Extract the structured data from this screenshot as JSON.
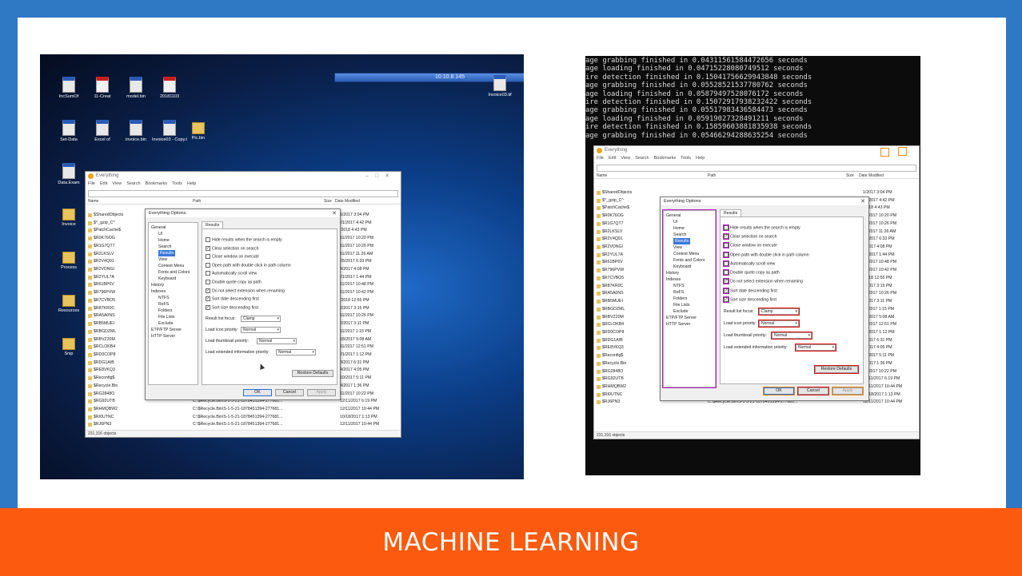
{
  "slide": {
    "footer_title": "MACHINE LEARNING"
  },
  "left": {
    "topbar_title": "10.10.8.145",
    "desktop_icons": [
      {
        "label": "IncSumOf",
        "kind": "doc"
      },
      {
        "label": "11-Creat",
        "kind": "pdf"
      },
      {
        "label": "model.bin",
        "kind": "doc"
      },
      {
        "label": "20181103",
        "kind": "pdf"
      },
      {
        "label": "Set-Data",
        "kind": "doc"
      },
      {
        "label": "Excel of",
        "kind": "doc"
      },
      {
        "label": "invoice.bin",
        "kind": "doc"
      },
      {
        "label": "Invoice03 - Copy.tif",
        "kind": "doc"
      },
      {
        "label": "Pic.bin",
        "kind": "fold"
      },
      {
        "label": "Data.Exam",
        "kind": "doc"
      },
      {
        "label": "Invoice",
        "kind": "fold"
      },
      {
        "label": "Process",
        "kind": "fold"
      },
      {
        "label": "Resources",
        "kind": "fold"
      },
      {
        "label": "Snip",
        "kind": "fold"
      }
    ],
    "top_right_icon_label": "Invoice03.tif"
  },
  "everything": {
    "title": "Everything",
    "menu": [
      "File",
      "Edit",
      "View",
      "Search",
      "Bookmarks",
      "Tools",
      "Help"
    ],
    "columns": {
      "name": "Name",
      "path": "Path",
      "size": "Size",
      "date": "Date Modified"
    },
    "rows": [
      {
        "name": "$SharedObjects",
        "path": "",
        "date": "1/2017 3:04 PM"
      },
      {
        "name": "$^_gzip_C^",
        "path": "",
        "date": "21/2017 4:42 PM"
      },
      {
        "name": "$PatchCache$",
        "path": "",
        "date": "/2018 4:43 PM"
      },
      {
        "name": "$R0K76OG",
        "path": "",
        "date": "11/2017 10:20 PM"
      },
      {
        "name": "$R1G7QT7",
        "path": "",
        "date": "11/2017 10:26 PM"
      },
      {
        "name": "$R2LKSLV",
        "path": "",
        "date": "11/2017 11:26 AM"
      },
      {
        "name": "$R2V4Q91",
        "path": "",
        "date": "25/2017 6:33 PM"
      },
      {
        "name": "$R2VDNGI",
        "path": "",
        "date": "4/2017 4:08 PM"
      },
      {
        "name": "$R2YUL7A",
        "path": "",
        "date": "21/2017 1:44 PM"
      },
      {
        "name": "$R61BP6V",
        "path": "",
        "date": "11/2017 10:48 PM"
      },
      {
        "name": "$R796PVW",
        "path": "",
        "date": "11/2017 10:42 PM"
      },
      {
        "name": "$R7CVBO5",
        "path": "",
        "date": "/2018 12:55 PM"
      },
      {
        "name": "$R87KR0C",
        "path": "",
        "date": "2/2017 3:15 PM"
      },
      {
        "name": "$RA5A0NS",
        "path": "",
        "date": "11/2017 10:26 PM"
      },
      {
        "name": "$RB5MUEI",
        "path": "",
        "date": "2/2017 3:11 PM"
      },
      {
        "name": "$RBGDZML",
        "path": "",
        "date": "11/2017 1:15 PM"
      },
      {
        "name": "$RBVZ20M",
        "path": "",
        "date": "18/2017 5:08 AM"
      },
      {
        "name": "$RCLOKB4",
        "path": "",
        "date": "11/2017 12:51 PM"
      },
      {
        "name": "$RD0COP8",
        "path": "",
        "date": "21/2017 1:12 PM"
      },
      {
        "name": "$RDG1AIB",
        "path": "",
        "date": "3/2017 6:31 PM"
      },
      {
        "name": "$RE8VKQ3",
        "path": "",
        "date": "4/2017 4:05 PM"
      },
      {
        "name": "$Reconfig$",
        "path": "",
        "date": "10/2017 5:11 PM"
      },
      {
        "name": "$Recycle.Bin",
        "path": "",
        "date": "4/2017 1:36 PM"
      },
      {
        "name": "$RG2848O",
        "path": "",
        "date": "11/2017 10:22 PM"
      },
      {
        "name": "$RG92UTB",
        "path": "C:\\$Recycle.Bin\\S-1-5-21-1878451394-277681...",
        "date": "12/11/2017 6:19 PM"
      },
      {
        "name": "$RHMQBW2",
        "path": "C:\\$Recycle.Bin\\S-1-5-21-1878451394-277681...",
        "date": "12/11/2017 10:44 PM"
      },
      {
        "name": "$RI0UTNC",
        "path": "C:\\$Recycle.Bin\\S-1-5-21-1878451394-277681...",
        "date": "10/18/2017 1:13 PM"
      },
      {
        "name": "$RJ6PN3",
        "path": "C:\\$Recycle.Bin\\S-1-5-21-1878451394-277681...",
        "date": "12/11/2017 10:44 PM"
      }
    ],
    "status": "231,316 objects"
  },
  "options": {
    "title": "Everything Options",
    "tree": [
      {
        "label": "General",
        "indent": 0
      },
      {
        "label": "UI",
        "indent": 1
      },
      {
        "label": "Home",
        "indent": 1
      },
      {
        "label": "Search",
        "indent": 1
      },
      {
        "label": "Results",
        "indent": 1,
        "selected": true
      },
      {
        "label": "View",
        "indent": 1
      },
      {
        "label": "Context Menu",
        "indent": 1
      },
      {
        "label": "Fonts and Colors",
        "indent": 1
      },
      {
        "label": "Keyboard",
        "indent": 1
      },
      {
        "label": "History",
        "indent": 0
      },
      {
        "label": "Indexes",
        "indent": 0
      },
      {
        "label": "NTFS",
        "indent": 1
      },
      {
        "label": "ReFS",
        "indent": 1
      },
      {
        "label": "Folders",
        "indent": 1
      },
      {
        "label": "File Lists",
        "indent": 1
      },
      {
        "label": "Exclude",
        "indent": 1
      },
      {
        "label": "ETP/FTP Server",
        "indent": 0
      },
      {
        "label": "HTTP Server",
        "indent": 0
      }
    ],
    "tab": "Results",
    "checkboxes": [
      {
        "label": "Hide results when the search is empty",
        "checked": false
      },
      {
        "label": "Clear selection on search",
        "checked": true
      },
      {
        "label": "Close window on execute",
        "checked": false
      },
      {
        "label": "Open path with double click in path column",
        "checked": false
      },
      {
        "label": "Automatically scroll view",
        "checked": false
      },
      {
        "label": "Double quote copy as path",
        "checked": false
      },
      {
        "label": "Do not select extension when renaming",
        "checked": true
      },
      {
        "label": "Sort date descending first",
        "checked": true
      },
      {
        "label": "Sort size descending first",
        "checked": true
      }
    ],
    "selects": [
      {
        "label": "Result list focus:",
        "value": "Clamp"
      },
      {
        "label": "Load icon priority:",
        "value": "Normal"
      },
      {
        "label": "Load thumbnail priority:",
        "value": "Normal"
      },
      {
        "label": "Load extended information priority:",
        "value": "Normal"
      }
    ],
    "restore_label": "Restore Defaults",
    "ok_label": "OK",
    "cancel_label": "Cancel",
    "apply_label": "Apply"
  },
  "console": {
    "lines": [
      "age grabbing finished in 0.04311561584472656 seconds",
      "age loading finished in 0.04715228080749512 seconds",
      "ire detection finished in 0.15041756629943848 seconds",
      "age grabbing finished in 0.05528521537780762 seconds",
      "age loading finished in 0.05879497528076172 seconds",
      "ire detection finished in 0.15072917938232422 seconds",
      "age grabbing finished in 0.05517983436584473 seconds",
      "age loading finished in 0.05919027328491211 seconds",
      "ire detection finished in 0.15859603881835938 seconds",
      "age grabbing finished in 0.05466294288635254 seconds"
    ]
  },
  "colors": {
    "background": "#2f78c4",
    "footer": "#fc5a0e",
    "highlight_red": "#e01010",
    "highlight_orange": "#f08a10",
    "highlight_purple": "#b020c0"
  }
}
